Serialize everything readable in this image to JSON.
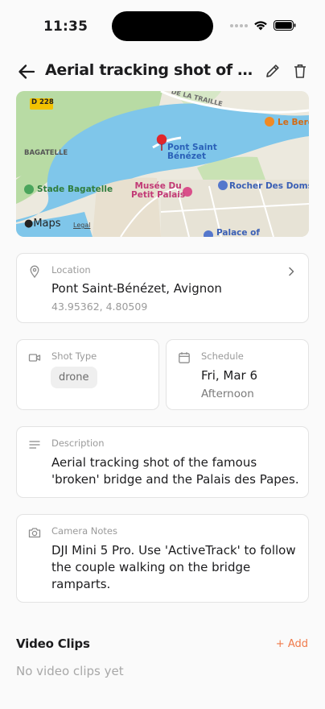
{
  "status_bar": {
    "time": "11:35"
  },
  "header": {
    "title": "Aerial tracking shot of the famous 'broken' bridge and the Palais des Papes"
  },
  "map": {
    "labels": {
      "road": "D 228",
      "street": "DE LA TRAILLE",
      "bagatelle": "BAGATELLE",
      "stade": "Stade Bagatelle",
      "pont": "Pont Saint\nBénézet",
      "pont1": "Pont Saint",
      "pont2": "Bénézet",
      "musee1": "Musée Du",
      "musee2": "Petit Palais",
      "rocher": "Rocher Des Doms",
      "palace": "Palace of",
      "le_berc": "Le Berc",
      "maps": "Maps",
      "legal": "Legal"
    },
    "colors": {
      "water": "#7fc6ea",
      "park": "#b8dba4",
      "land": "#ece9de",
      "pin": "#e0262b"
    }
  },
  "location": {
    "label": "Location",
    "name": "Pont Saint-Bénézet, Avignon",
    "coords": "43.95362, 4.80509"
  },
  "shot_type": {
    "label": "Shot Type",
    "value": "drone"
  },
  "schedule": {
    "label": "Schedule",
    "date": "Fri, Mar 6",
    "time_of_day": "Afternoon"
  },
  "description": {
    "label": "Description",
    "line1": "Aerial tracking shot of the famous",
    "line2": "'broken' bridge and the Palais des Papes."
  },
  "camera_notes": {
    "label": "Camera Notes",
    "line1": "DJI Mini 5 Pro. Use 'ActiveTrack' to follow",
    "line2": "the couple walking on the bridge",
    "line3": "ramparts."
  },
  "video_clips": {
    "title": "Video Clips",
    "add_label": "+ Add",
    "empty": "No video clips yet"
  },
  "accent_color": "#f07a4a"
}
